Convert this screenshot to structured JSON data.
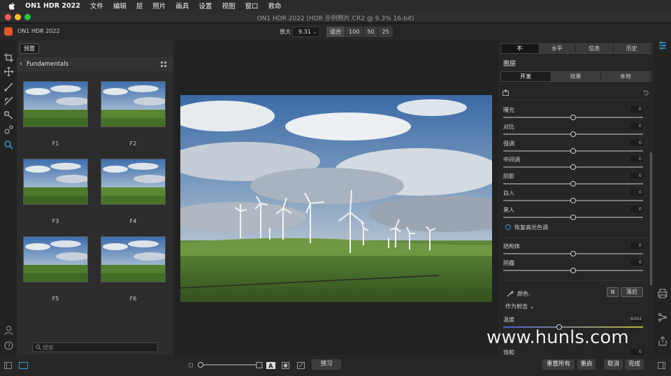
{
  "menubar": {
    "items": [
      "ON1 HDR 2022",
      "文件",
      "编辑",
      "层",
      "照片",
      "画具",
      "设置",
      "视图",
      "窗口",
      "救命"
    ]
  },
  "window": {
    "title": "ON1 HDR 2022 (HDR 示例照片.CR2 @ 9.3% 16-bit)"
  },
  "toolbar": {
    "app_name": "ON1 HDR 2022",
    "zoom_label": "放大",
    "zoom_value": "9.31",
    "zoom_buttons": [
      "适合",
      "100",
      "50",
      "25"
    ]
  },
  "browser": {
    "tab_label": "预置",
    "category": "Fundamentals",
    "thumbnails": [
      "F1",
      "F2",
      "F3",
      "F4",
      "F5",
      "F6"
    ],
    "search_placeholder": "搜索"
  },
  "right_panel": {
    "tabs": [
      "不",
      "水平",
      "信息",
      "历史"
    ],
    "layers_title": "图层",
    "sub_tabs": [
      "开发",
      "效果",
      "本地"
    ],
    "adjustments": [
      {
        "label": "曝光",
        "value": "0",
        "level": 0.5
      },
      {
        "label": "对比",
        "value": "0",
        "level": 0.5
      },
      {
        "label": "强调",
        "value": "0",
        "level": 0.5
      },
      {
        "label": "中间调",
        "value": "0",
        "level": 0.5
      },
      {
        "label": "阴影",
        "value": "0",
        "level": 0.5
      },
      {
        "label": "白人",
        "value": "0",
        "level": 0.5
      },
      {
        "label": "黑人",
        "value": "0",
        "level": 0.5
      }
    ],
    "recover_highlights": "恢复高光色调",
    "structure": [
      {
        "label": "结构体",
        "value": "0",
        "level": 0.5
      },
      {
        "label": "阴霾",
        "value": "0",
        "level": 0.5
      }
    ],
    "color_label": "颜色:",
    "wb_picker_label": "⌘",
    "wb_preset_label": "落后",
    "wb_mode": "作为射击",
    "temperature": {
      "label": "温度",
      "value": "6002",
      "level": 0.4
    },
    "saturation_label": "饱和",
    "saturation_value": "0"
  },
  "bottombar": {
    "preview_label": "预习",
    "actions": [
      "重置所有",
      "重启",
      "取消",
      "完成"
    ],
    "thumb_size_level": 0.0
  },
  "watermark": "www.hunls.com",
  "colors": {
    "accent": "#3d9ad6",
    "logo": "#e2572c"
  }
}
